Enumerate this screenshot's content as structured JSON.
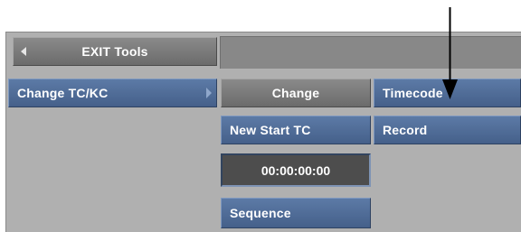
{
  "exit_tools": {
    "label": "EXIT Tools",
    "icon": "triangle-left-icon"
  },
  "menu": {
    "change_tc_kc": {
      "label": "Change TC/KC",
      "icon": "triangle-right-icon"
    }
  },
  "controls": {
    "change_button": "Change",
    "mode_selector": "Timecode",
    "new_start_tc_label": "New Start TC",
    "record_button": "Record",
    "timecode_value": "00:00:00:00",
    "sequence_button": "Sequence"
  },
  "annotation": {
    "icon": "pointer-arrow-icon"
  },
  "colors": {
    "panel": "#b0b0b0",
    "button_gray": "#7a7a7a",
    "button_blue": "#5070a0",
    "field": "#4d4d4d",
    "text": "#ffffff"
  }
}
